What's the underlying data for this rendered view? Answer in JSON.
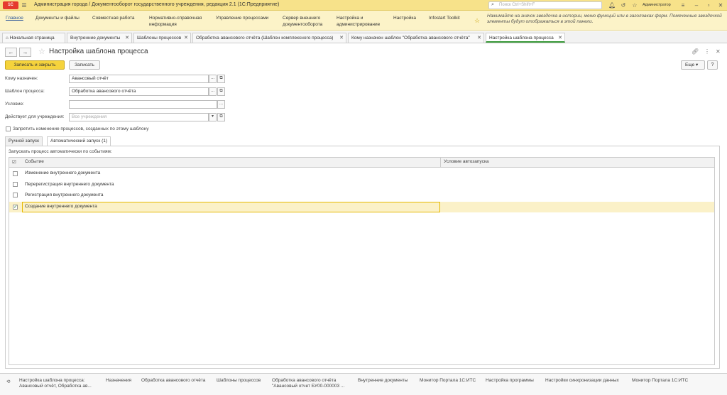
{
  "titlebar": {
    "logo": "1С",
    "title": "Администрация города / Документооборот государственного учреждения, редакция 2.1  (1С:Предприятие)",
    "search_placeholder": "Поиск Ctrl+Shift+F",
    "user": "Администратор"
  },
  "sections": [
    "Главное",
    "Документы и файлы",
    "Совместная работа",
    "Нормативно-справочная информация",
    "Управление процессами",
    "Сервер внешнего документооборота",
    "Настройка и администрирование",
    "Настройка",
    "Infostart Toolkit"
  ],
  "hint": "Нажимайте на значок звездочка в истории, меню функций или в заголовках форм. Помеченные звездочкой элементы будут отображаться в этой панели.",
  "open_tabs": [
    "Начальная страница",
    "Внутренние документы",
    "Шаблоны процессов",
    "Обработка авансового отчёта (Шаблон комплексного процесса)",
    "Кому назначен шаблон \"Обработка авансового отчёта\"",
    "Настройка шаблона процесса"
  ],
  "form": {
    "title": "Настройка шаблона процесса",
    "save_close": "Записать и закрыть",
    "save": "Записать",
    "more": "Еще",
    "help": "?",
    "assigned_label": "Кому назначен:",
    "assigned_value": "Авансовый отчёт",
    "template_label": "Шаблон процесса:",
    "template_value": "Обработка авансового отчёта",
    "condition_label": "Условие:",
    "condition_value": "",
    "institution_label": "Действует для учреждения:",
    "institution_placeholder": "Все учреждения",
    "prohibit_label": "Запретить изменение процессов, созданных по этому шаблону",
    "tab_manual": "Ручной запуск",
    "tab_auto": "Автоматический запуск (1)",
    "events_caption": "Запускать процесс автоматически по событиям:",
    "col_event": "Событие",
    "col_condition": "Условие автозапуска"
  },
  "events": [
    {
      "label": "Изменение внутреннего документа",
      "checked": false
    },
    {
      "label": "Перерегистрация внутреннего документа",
      "checked": false
    },
    {
      "label": "Регистрация внутреннего документа",
      "checked": false
    },
    {
      "label": "Создание внутреннего документа",
      "checked": true
    }
  ],
  "bottom_history": [
    "Настройка шаблона процесса: Авансовый отчёт, Обработка ав...",
    "Назначения",
    "Обработка авансового отчёта",
    "Шаблоны процессов",
    "Обработка авансового отчёта \"Авансовый отчет БУ00-000003 ...",
    "Внутренние документы",
    "Монитор Портала 1С:ИТС",
    "Настройка программы",
    "Настройки синхронизации данных",
    "Монитор Портала 1С:ИТС"
  ]
}
